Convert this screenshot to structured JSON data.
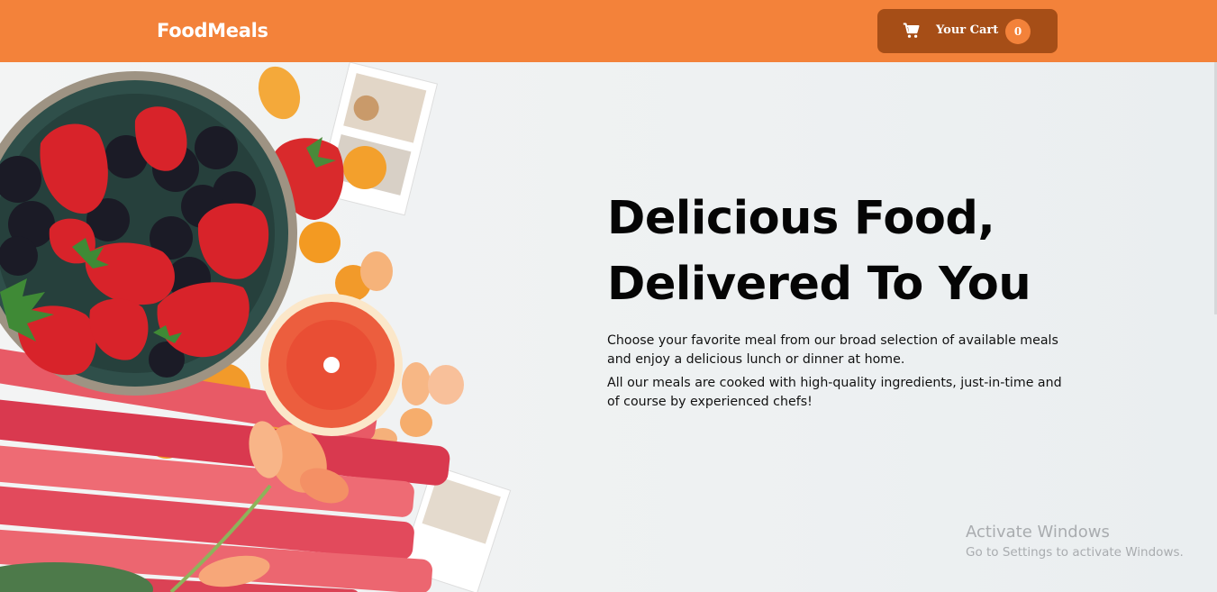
{
  "header": {
    "logo": "FoodMeals",
    "cart": {
      "icon": "cart-icon",
      "label": "Your Cart",
      "count": "0"
    }
  },
  "hero": {
    "image": "food-flatlay-image",
    "headline": "Delicious Food, Delivered To You",
    "paragraph_1": "Choose your favorite meal from our broad selection of available meals and enjoy a delicious lunch or dinner at home.",
    "paragraph_2": "All our meals are cooked with high-quality ingredients, just-in-time and of course by experienced chefs!"
  },
  "watermark": {
    "title": "Activate Windows",
    "subtitle": "Go to Settings to activate Windows."
  },
  "colors": {
    "header": "#f3823a",
    "cart_button": "#a64e17",
    "badge": "#f3823a"
  }
}
